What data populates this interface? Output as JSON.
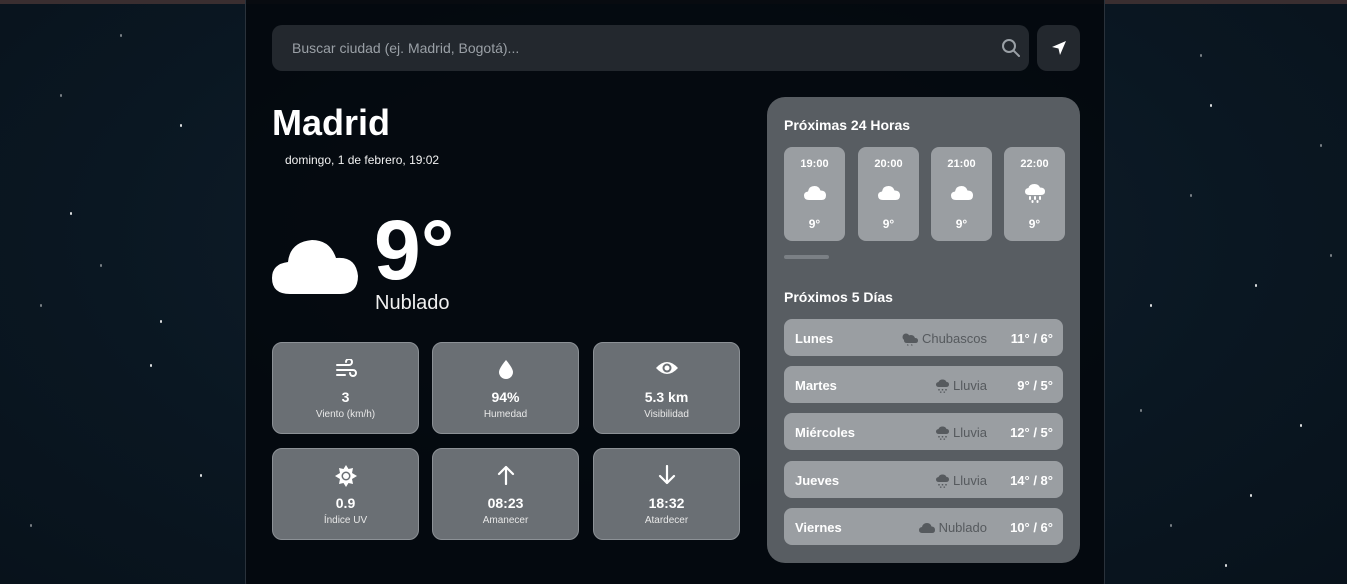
{
  "search": {
    "placeholder": "Buscar ciudad (ej. Madrid, Bogotá)..."
  },
  "current": {
    "city": "Madrid",
    "date": "domingo, 1 de febrero, 19:02",
    "temp": "9°",
    "condition": "Nublado",
    "icon": "cloud-icon"
  },
  "details": [
    {
      "icon": "wind-icon",
      "value": "3",
      "label": "Viento (km/h)"
    },
    {
      "icon": "droplet-icon",
      "value": "94%",
      "label": "Humedad"
    },
    {
      "icon": "eye-icon",
      "value": "5.3 km",
      "label": "Visibilidad"
    },
    {
      "icon": "sun-icon",
      "value": "0.9",
      "label": "Índice UV"
    },
    {
      "icon": "arrow-up-icon",
      "value": "08:23",
      "label": "Amanecer"
    },
    {
      "icon": "arrow-down-icon",
      "value": "18:32",
      "label": "Atardecer"
    }
  ],
  "hourly": {
    "title": "Próximas 24 Horas",
    "items": [
      {
        "time": "19:00",
        "icon": "cloud-icon",
        "temp": "9°"
      },
      {
        "time": "20:00",
        "icon": "cloud-icon",
        "temp": "9°"
      },
      {
        "time": "21:00",
        "icon": "cloud-icon",
        "temp": "9°"
      },
      {
        "time": "22:00",
        "icon": "cloud-rain-icon",
        "temp": "9°"
      }
    ]
  },
  "daily": {
    "title": "Próximos 5 Días",
    "items": [
      {
        "day": "Lunes",
        "icon": "cloud-sun-rain-icon",
        "condition": "Chubascos",
        "temps": "11° / 6°"
      },
      {
        "day": "Martes",
        "icon": "cloud-rain-icon",
        "condition": "Lluvia",
        "temps": "9° / 5°"
      },
      {
        "day": "Miércoles",
        "icon": "cloud-rain-icon",
        "condition": "Lluvia",
        "temps": "12° / 5°"
      },
      {
        "day": "Jueves",
        "icon": "cloud-rain-icon",
        "condition": "Lluvia",
        "temps": "14° / 8°"
      },
      {
        "day": "Viernes",
        "icon": "cloud-icon",
        "condition": "Nublado",
        "temps": "10° / 6°"
      }
    ]
  },
  "colors": {
    "panel": "#585d62",
    "tile": "#6a6f74",
    "card": "#04090e",
    "background": "#0b1520"
  }
}
